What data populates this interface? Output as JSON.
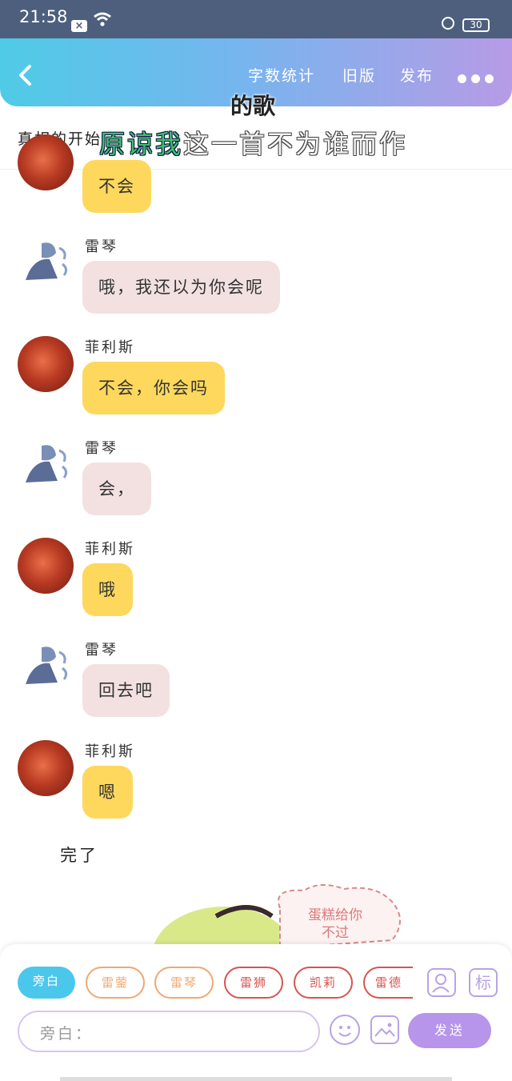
{
  "status_bar": {
    "time": "21:58",
    "battery": "30"
  },
  "header": {
    "nav": {
      "word_count": "字数统计",
      "old_version": "旧版",
      "publish": "发布"
    },
    "title_left": "真相的开始",
    "lyric_line1": "的歌",
    "lyric_line2_highlight": "原谅我",
    "lyric_line2_rest": "这一首不为谁而作"
  },
  "messages": [
    {
      "speaker": "",
      "text": "不会",
      "style": "yellow"
    },
    {
      "speaker": "雷琴",
      "text": "哦，我还以为你会呢",
      "style": "pink"
    },
    {
      "speaker": "菲利斯",
      "text": "不会，你会吗",
      "style": "yellow"
    },
    {
      "speaker": "雷琴",
      "text": "会，",
      "style": "pink"
    },
    {
      "speaker": "菲利斯",
      "text": "哦",
      "style": "yellow"
    },
    {
      "speaker": "雷琴",
      "text": "回去吧",
      "style": "pink"
    },
    {
      "speaker": "菲利斯",
      "text": "嗯",
      "style": "yellow"
    }
  ],
  "narration": "完了",
  "sticker": {
    "line1": "蛋糕给你",
    "line2": "不过"
  },
  "character_chips": [
    {
      "label": "旁白",
      "selected": true,
      "color": "#4cc7ec"
    },
    {
      "label": "雷蓥",
      "selected": false,
      "color": "#f0a872"
    },
    {
      "label": "雷琴",
      "selected": false,
      "color": "#f0a872"
    },
    {
      "label": "雷狮",
      "selected": false,
      "color": "#d9534f"
    },
    {
      "label": "凯莉",
      "selected": false,
      "color": "#d9534f"
    },
    {
      "label": "雷德",
      "selected": false,
      "color": "#d9534f"
    }
  ],
  "toolbar": {
    "mark_label": "标"
  },
  "input": {
    "placeholder": "旁白："
  },
  "send_label": "发送"
}
